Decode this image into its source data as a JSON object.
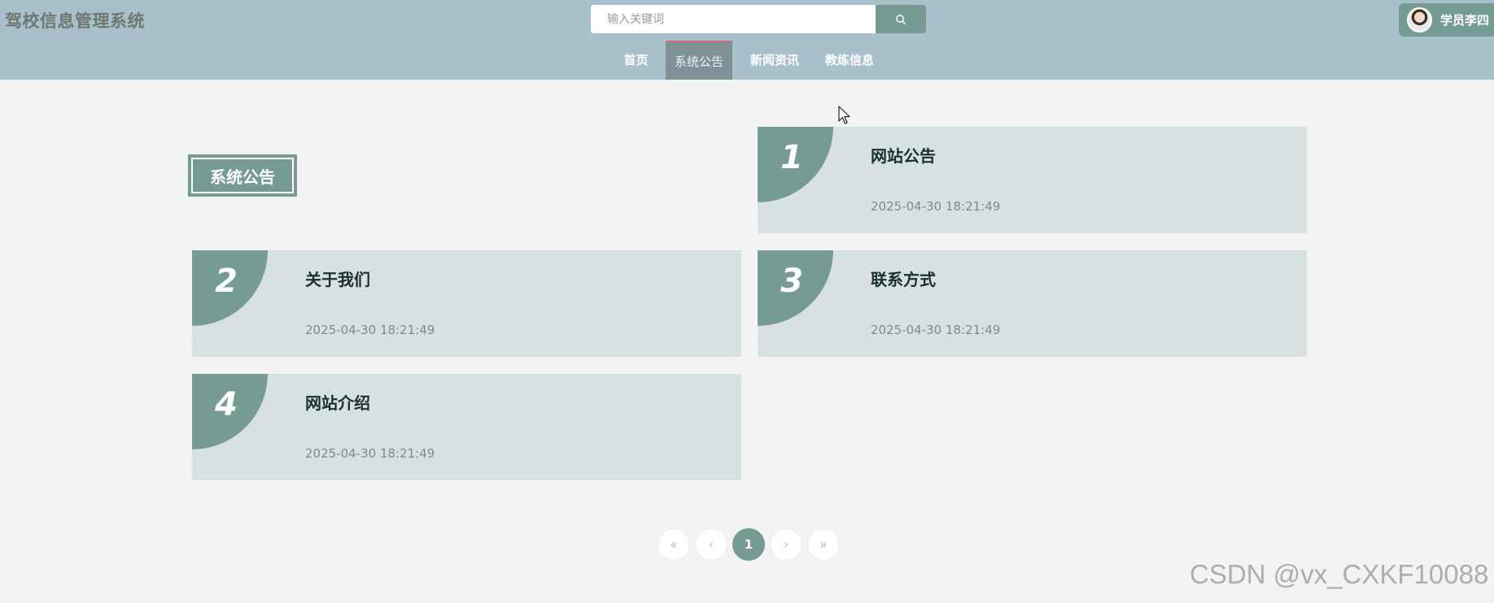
{
  "header": {
    "site_title": "驾校信息管理系统",
    "search_placeholder": "输入关键词",
    "user_name": "学员李四"
  },
  "nav": {
    "items": [
      {
        "label": "首页",
        "active": false
      },
      {
        "label": "系统公告",
        "active": true
      },
      {
        "label": "新闻资讯",
        "active": false
      },
      {
        "label": "教练信息",
        "active": false
      }
    ]
  },
  "section": {
    "title": "系统公告"
  },
  "announcements": [
    {
      "number": "1",
      "title": "网站公告",
      "date": "2025-04-30 18:21:49"
    },
    {
      "number": "2",
      "title": "关于我们",
      "date": "2025-04-30 18:21:49"
    },
    {
      "number": "3",
      "title": "联系方式",
      "date": "2025-04-30 18:21:49"
    },
    {
      "number": "4",
      "title": "网站介绍",
      "date": "2025-04-30 18:21:49"
    }
  ],
  "pagination": {
    "first": "«",
    "prev": "‹",
    "current": "1",
    "next": "›",
    "last": "»"
  },
  "watermark": "CSDN @vx_CXKF10088",
  "colors": {
    "header_bg": "#a7c0cc",
    "accent": "#759b94",
    "card_bg": "#d7e1e2",
    "page_bg": "#f3f3f3"
  }
}
